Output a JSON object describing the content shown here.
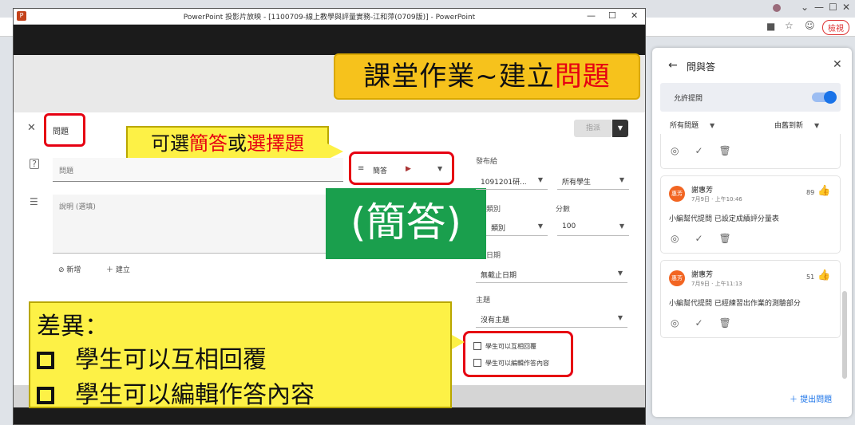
{
  "browser": {
    "tab_controls": [
      "⌄",
      "—",
      "☐",
      "✕"
    ],
    "extension_pill": "檢視"
  },
  "ppt": {
    "title": "PowerPoint 投影片放映 - [1100709-線上教學與評量實務-江和萍(0709版)] - PowerPoint",
    "logo": "P"
  },
  "slide": {
    "title_parts": [
      "課堂作業~建立",
      "問題"
    ],
    "q_tag": "問題",
    "assign_button": "指派",
    "choice_callout": [
      "可選",
      "簡答",
      "或",
      "選擇題"
    ],
    "question_placeholder": "問題",
    "description_placeholder": "說明 (選填)",
    "type_select": "簡答",
    "answer_label": "(簡答)",
    "attach_label": "新增",
    "create_label": "建立",
    "for_label": "發布給",
    "class_value": "1091201研...",
    "students_value": "所有學生",
    "category_label": "類別",
    "category_value": "類別",
    "points_label": "分數",
    "points_value": "100",
    "due_label": "日期",
    "due_value": "無截止日期",
    "topic_label": "主題",
    "topic_value": "沒有主題",
    "checkbox_reply": "學生可以互相回覆",
    "checkbox_edit": "學生可以編輯作答內容",
    "diff_title": "差異：",
    "diff_items": [
      "學生可以互相回覆",
      "學生可以編輯作答內容"
    ]
  },
  "qa": {
    "title": "問與答",
    "allow_label": "允許提問",
    "filter_all": "所有問題",
    "sort": "由舊到新",
    "ask_button": "提出問題",
    "questions": [
      {
        "avatar": "惠芳",
        "name": "謝惠芳",
        "time": "7月9日 · 上午10:46",
        "votes": "89",
        "text": "小編幫代提問 已設定成績評分量表"
      },
      {
        "avatar": "惠芳",
        "name": "謝惠芳",
        "time": "7月9日 · 上午11:13",
        "votes": "51",
        "text": "小編幫代提問 已經練習出作業的測驗部分"
      }
    ]
  }
}
